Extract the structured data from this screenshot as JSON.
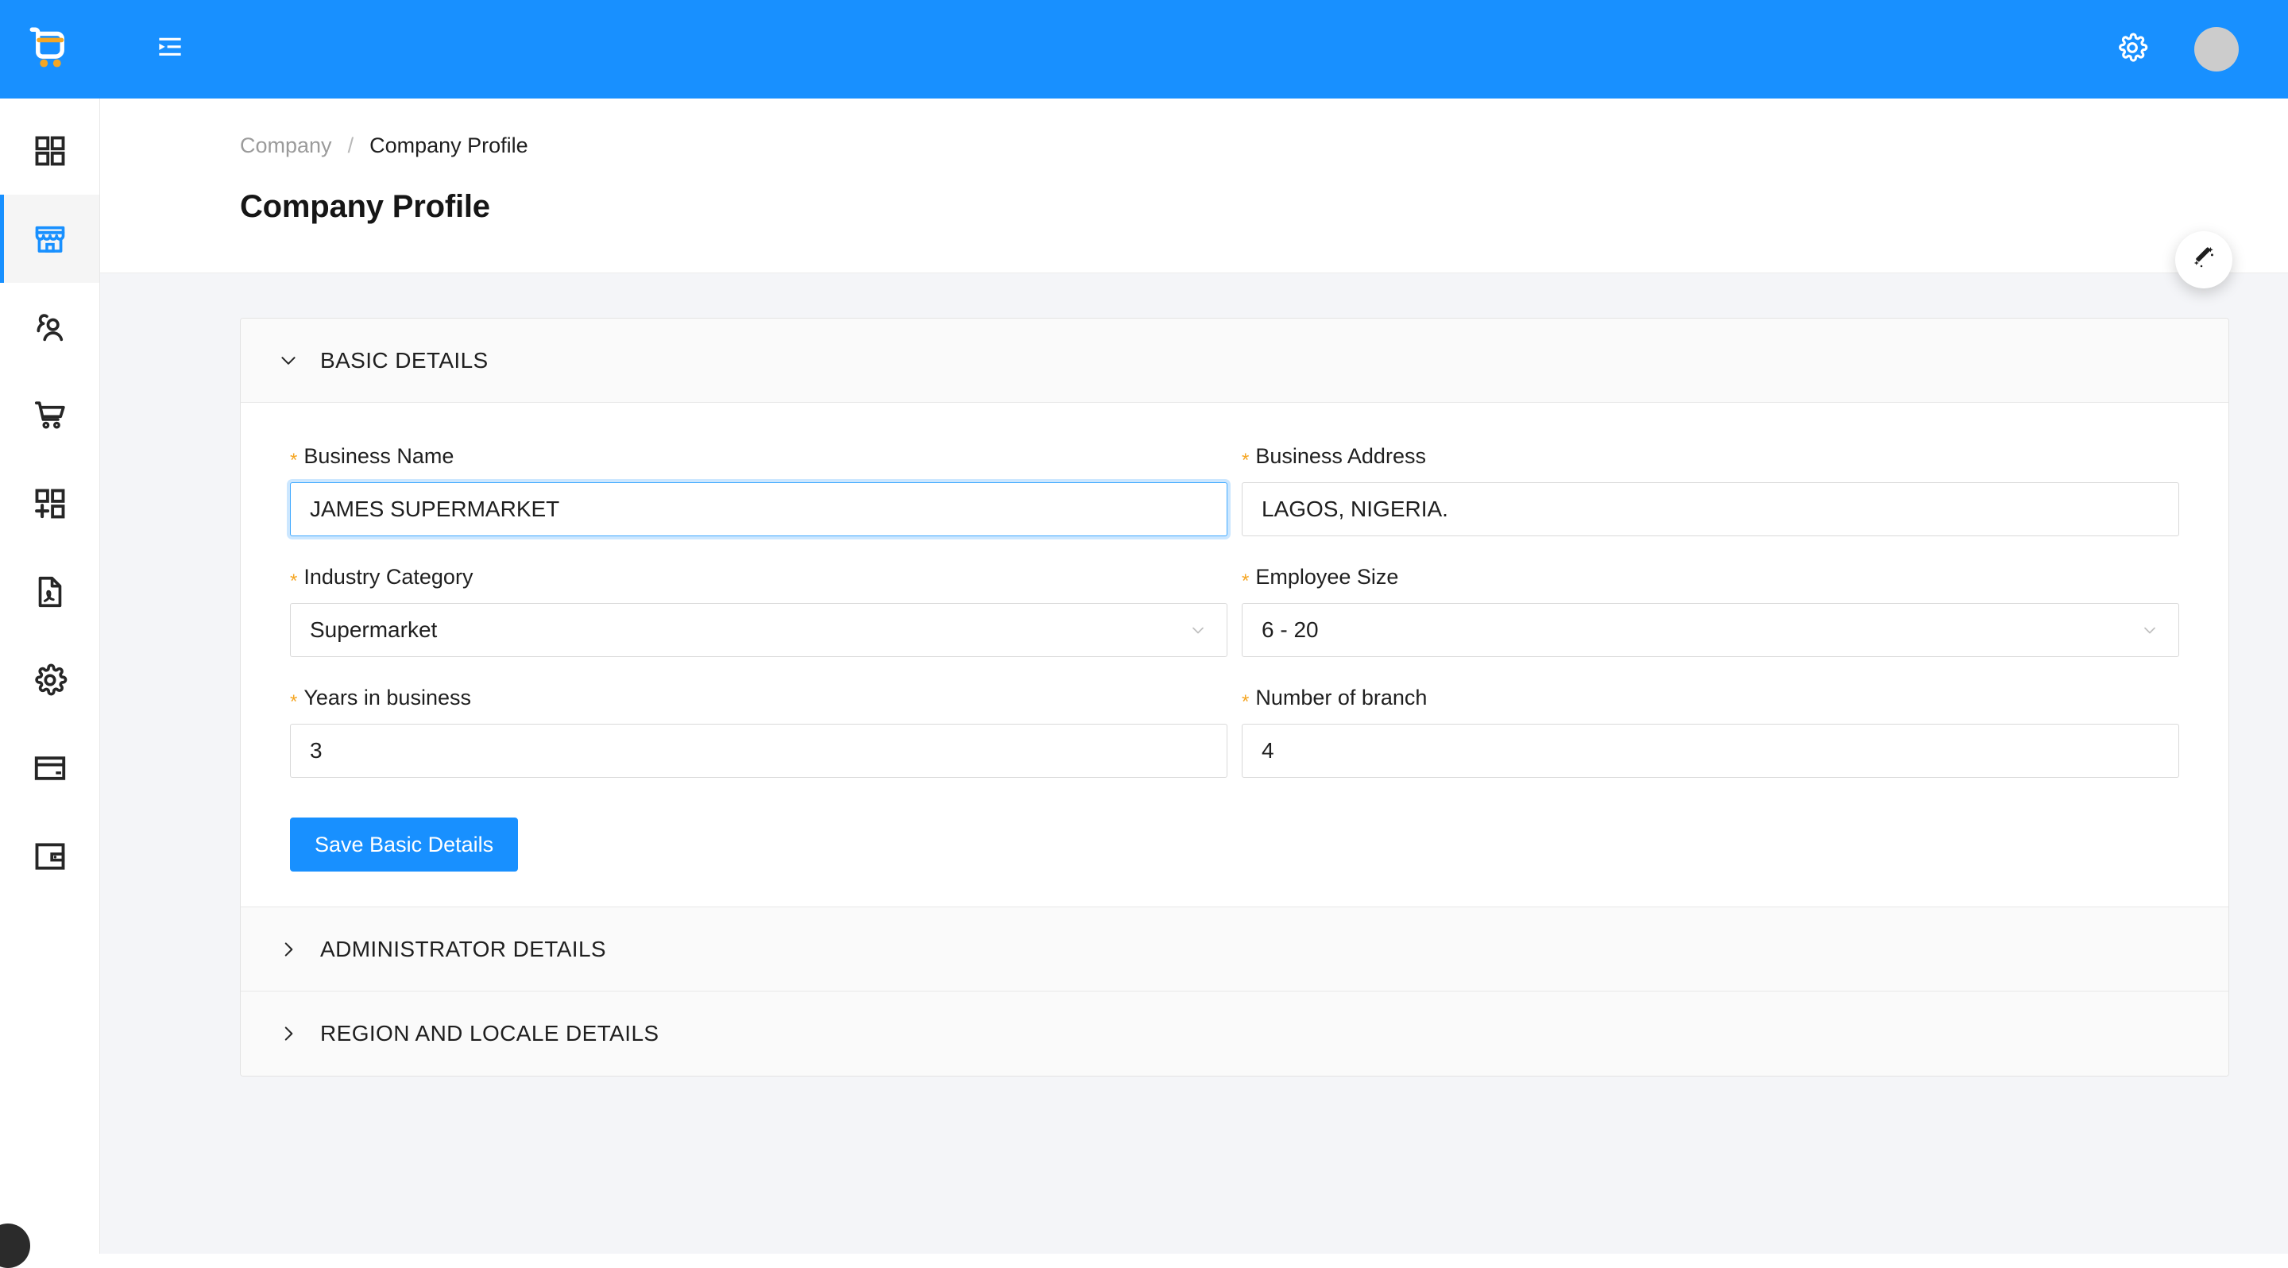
{
  "topbar": {
    "logo_name": "shopping-cart-logo",
    "collapse_icon": "menu-unfold-icon",
    "gear_icon": "gear-icon",
    "avatar_label": ""
  },
  "sidebar": {
    "items": [
      {
        "name": "dashboard",
        "icon": "grid-icon",
        "active": false
      },
      {
        "name": "company",
        "icon": "store-icon",
        "active": true
      },
      {
        "name": "customers",
        "icon": "users-icon",
        "active": false
      },
      {
        "name": "orders",
        "icon": "cart-icon",
        "active": false
      },
      {
        "name": "add-module",
        "icon": "grid-plus-icon",
        "active": false
      },
      {
        "name": "reports",
        "icon": "pdf-file-icon",
        "active": false
      },
      {
        "name": "settings",
        "icon": "gear-icon",
        "active": false
      },
      {
        "name": "payments",
        "icon": "credit-card-icon",
        "active": false
      },
      {
        "name": "wallet",
        "icon": "wallet-icon",
        "active": false
      }
    ]
  },
  "breadcrumb": {
    "parent": "Company",
    "separator": "/",
    "current": "Company Profile"
  },
  "page": {
    "title": "Company Profile"
  },
  "panels": [
    {
      "id": "basic-details",
      "title": "BASIC DETAILS",
      "expanded": true,
      "arrow": "chevron-down-icon"
    },
    {
      "id": "administrator-details",
      "title": "ADMINISTRATOR DETAILS",
      "expanded": false,
      "arrow": "chevron-right-icon"
    },
    {
      "id": "region-and-locale-details",
      "title": "REGION AND LOCALE DETAILS",
      "expanded": false,
      "arrow": "chevron-right-icon"
    }
  ],
  "form": {
    "required_marker": "*",
    "business_name": {
      "label": "Business Name",
      "value": "JAMES SUPERMARKET",
      "placeholder": "Business Name",
      "focused": true
    },
    "business_address": {
      "label": "Business Address",
      "value": "LAGOS, NIGERIA.",
      "placeholder": "Business Address",
      "focused": false
    },
    "industry_category": {
      "label": "Industry Category",
      "value": "Supermarket",
      "options": [
        "Supermarket"
      ]
    },
    "employee_size": {
      "label": "Employee Size",
      "value": "6 - 20",
      "options": [
        "6 - 20"
      ]
    },
    "years_in_business": {
      "label": "Years in business",
      "value": "3",
      "placeholder": "Years in business"
    },
    "number_of_branch": {
      "label": "Number of branch",
      "value": "4",
      "placeholder": "Number of branch"
    },
    "save_label": "Save Basic Details"
  },
  "fab": {
    "icon": "magic-wand-icon"
  },
  "colors": {
    "brand_blue": "#1890ff",
    "accent_orange": "#f5a623",
    "required_star": "#f5a623",
    "content_bg": "#f4f5f8",
    "panel_header_bg": "#fafafa",
    "border": "#e8e8e8",
    "text_primary": "#1f1f1f",
    "text_muted": "#9b9b9b"
  }
}
